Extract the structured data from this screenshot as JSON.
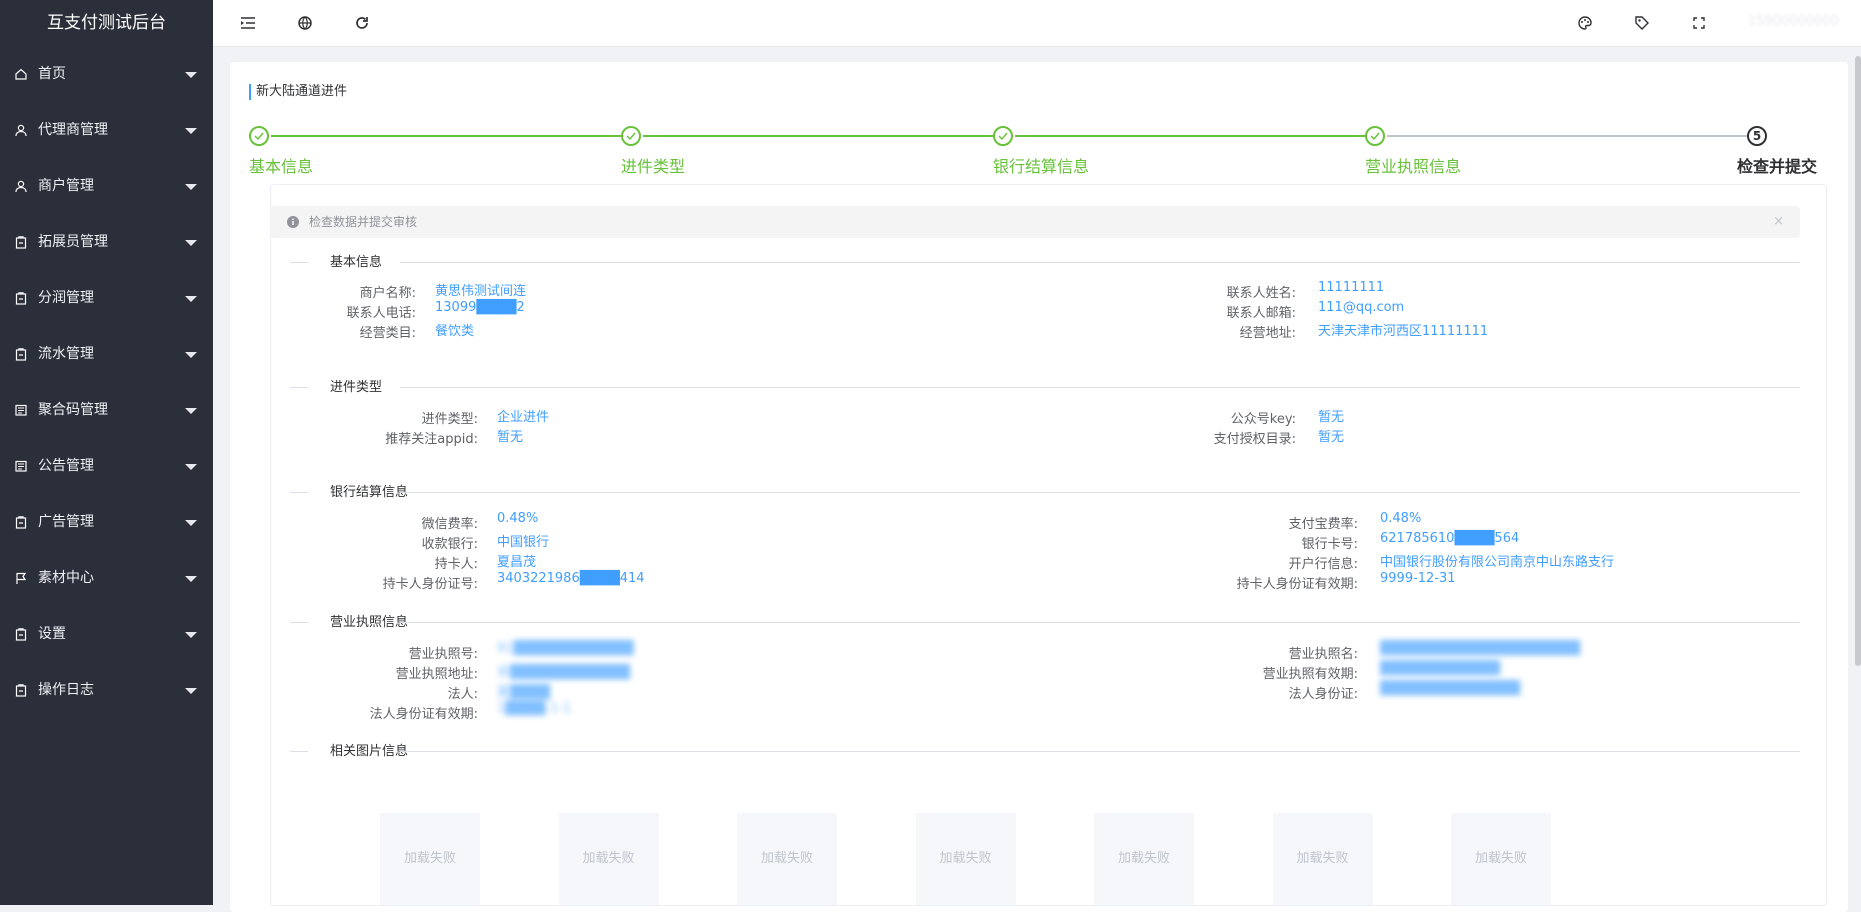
{
  "app": {
    "title": "互支付测试后台"
  },
  "sidebar": {
    "items": [
      {
        "label": "首页",
        "icon": "home-icon"
      },
      {
        "label": "代理商管理",
        "icon": "user-icon"
      },
      {
        "label": "商户管理",
        "icon": "user-icon"
      },
      {
        "label": "拓展员管理",
        "icon": "clipboard-icon"
      },
      {
        "label": "分润管理",
        "icon": "clipboard-icon"
      },
      {
        "label": "流水管理",
        "icon": "clipboard-icon"
      },
      {
        "label": "聚合码管理",
        "icon": "list-icon"
      },
      {
        "label": "公告管理",
        "icon": "list-icon"
      },
      {
        "label": "广告管理",
        "icon": "clipboard-icon"
      },
      {
        "label": "素材中心",
        "icon": "flag-icon"
      },
      {
        "label": "设置",
        "icon": "clipboard-icon"
      },
      {
        "label": "操作日志",
        "icon": "clipboard-icon"
      }
    ]
  },
  "topbar": {
    "icons_left": [
      "menu-fold-icon",
      "globe-icon",
      "refresh-icon"
    ],
    "icons_right": [
      "palette-icon",
      "tag-icon",
      "fullscreen-icon"
    ],
    "user_name": "15900000000"
  },
  "page": {
    "title": "新大陆通道进件"
  },
  "steps": [
    {
      "label": "基本信息",
      "status": "done"
    },
    {
      "label": "进件类型",
      "status": "done"
    },
    {
      "label": "银行结算信息",
      "status": "done"
    },
    {
      "label": "营业执照信息",
      "status": "done"
    },
    {
      "label": "检查并提交",
      "status": "active",
      "number": "5"
    }
  ],
  "alert": {
    "text": "检查数据并提交审核",
    "close": "×"
  },
  "sections": {
    "basic": {
      "title": "基本信息",
      "left": [
        {
          "label": "商户名称:",
          "value": "黄思伟测试间连"
        },
        {
          "label": "联系人电话:",
          "value": "13099████2"
        },
        {
          "label": "经营类目:",
          "value": "餐饮类"
        }
      ],
      "right": [
        {
          "label": "联系人姓名:",
          "value": "11111111"
        },
        {
          "label": "联系人邮箱:",
          "value": "111@qq.com"
        },
        {
          "label": "经营地址:",
          "value": "天津天津市河西区11111111"
        }
      ]
    },
    "type": {
      "title": "进件类型",
      "left": [
        {
          "label": "进件类型:",
          "value": "企业进件"
        },
        {
          "label": "推荐关注appid:",
          "value": "暂无"
        }
      ],
      "right": [
        {
          "label": "公众号key:",
          "value": "暂无"
        },
        {
          "label": "支付授权目录:",
          "value": "暂无"
        }
      ]
    },
    "bank": {
      "title": "银行结算信息",
      "left": [
        {
          "label": "微信费率:",
          "value": "0.48%"
        },
        {
          "label": "收款银行:",
          "value": "中国银行"
        },
        {
          "label": "持卡人:",
          "value": "夏昌茂"
        },
        {
          "label": "持卡人身份证号:",
          "value": "3403221986████414"
        }
      ],
      "right": [
        {
          "label": "支付宝费率:",
          "value": "0.48%"
        },
        {
          "label": "银行卡号:",
          "value": "621785610████564"
        },
        {
          "label": "开户行信息:",
          "value": "中国银行股份有限公司南京中山东路支行"
        },
        {
          "label": "持卡人身份证有效期:",
          "value": "9999-12-31"
        }
      ]
    },
    "license": {
      "title": "营业执照信息",
      "left": [
        {
          "label": "营业执照号:",
          "value": "91████████████"
        },
        {
          "label": "营业执照地址:",
          "value": "安████████████"
        },
        {
          "label": "法人:",
          "value": "夏████"
        },
        {
          "label": "法人身份证有效期:",
          "value": "1████-1-1"
        }
      ],
      "right": [
        {
          "label": "营业执照名:",
          "value": "████████████████████"
        },
        {
          "label": "营业执照有效期:",
          "value": "████████████"
        },
        {
          "label": "法人身份证:",
          "value": "██████████████"
        }
      ]
    },
    "images": {
      "title": "相关图片信息",
      "items": [
        "加载失败",
        "加载失败",
        "加载失败",
        "加载失败",
        "加载失败",
        "加载失败",
        "加载失败"
      ]
    }
  },
  "colors": {
    "sidebar_bg": "#2b2f3a",
    "accent": "#409eff",
    "success": "#67c23a"
  }
}
